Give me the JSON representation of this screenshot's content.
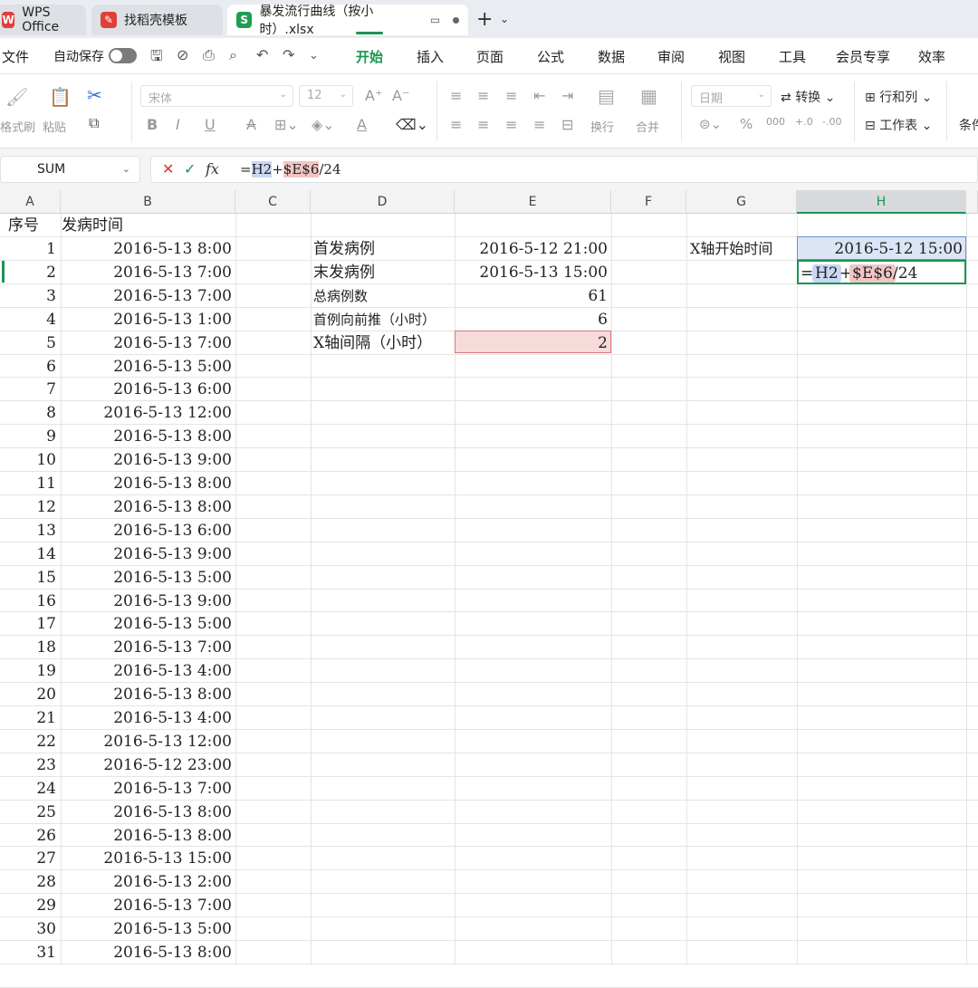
{
  "tabs": {
    "wps": "WPS Office",
    "template": "找稻壳模板",
    "file": "暴发流行曲线（按小时）.xlsx",
    "add": "+",
    "more": "⌄"
  },
  "menu": {
    "file": "文件",
    "autosave": "自动保存",
    "items": [
      "开始",
      "插入",
      "页面",
      "公式",
      "数据",
      "审阅",
      "视图",
      "工具",
      "会员专享",
      "效率"
    ],
    "active": "开始"
  },
  "ribbon": {
    "format_painter": "格式刷",
    "paste": "粘贴",
    "font_name": "宋体",
    "font_size": "12",
    "wrap": "换行",
    "merge": "合并",
    "number_format": "日期",
    "convert": "转换",
    "rows_cols": "行和列",
    "worksheet": "工作表",
    "conditional": "条件",
    "bold": "B",
    "italic": "I",
    "underline": "U",
    "strike": "A",
    "font_color": "A",
    "percent": "%",
    "thousands": "000",
    "dec_inc": "+.0",
    "dec_dec": "-.00"
  },
  "formula_bar": {
    "name_box": "SUM",
    "cancel": "✕",
    "confirm": "✓",
    "fx": "fx",
    "formula_eq": "=",
    "formula_ref1": "H2",
    "formula_plus": "+",
    "formula_ref2": "$E$6",
    "formula_tail": "/24"
  },
  "columns": [
    "A",
    "B",
    "C",
    "D",
    "E",
    "F",
    "G",
    "H"
  ],
  "selected_column": "H",
  "sheet": {
    "header_a": "序号",
    "header_b": "发病时间",
    "rows": [
      {
        "no": "1",
        "time": "2016-5-13  8:00"
      },
      {
        "no": "2",
        "time": "2016-5-13  7:00"
      },
      {
        "no": "3",
        "time": "2016-5-13  7:00"
      },
      {
        "no": "4",
        "time": "2016-5-13  1:00"
      },
      {
        "no": "5",
        "time": "2016-5-13  7:00"
      },
      {
        "no": "6",
        "time": "2016-5-13  5:00"
      },
      {
        "no": "7",
        "time": "2016-5-13  6:00"
      },
      {
        "no": "8",
        "time": "2016-5-13  12:00"
      },
      {
        "no": "9",
        "time": "2016-5-13  8:00"
      },
      {
        "no": "10",
        "time": "2016-5-13  9:00"
      },
      {
        "no": "11",
        "time": "2016-5-13  8:00"
      },
      {
        "no": "12",
        "time": "2016-5-13  8:00"
      },
      {
        "no": "13",
        "time": "2016-5-13  6:00"
      },
      {
        "no": "14",
        "time": "2016-5-13  9:00"
      },
      {
        "no": "15",
        "time": "2016-5-13  5:00"
      },
      {
        "no": "16",
        "time": "2016-5-13  9:00"
      },
      {
        "no": "17",
        "time": "2016-5-13  5:00"
      },
      {
        "no": "18",
        "time": "2016-5-13  7:00"
      },
      {
        "no": "19",
        "time": "2016-5-13  4:00"
      },
      {
        "no": "20",
        "time": "2016-5-13  8:00"
      },
      {
        "no": "21",
        "time": "2016-5-13  4:00"
      },
      {
        "no": "22",
        "time": "2016-5-13  12:00"
      },
      {
        "no": "23",
        "time": "2016-5-12  23:00"
      },
      {
        "no": "24",
        "time": "2016-5-13  7:00"
      },
      {
        "no": "25",
        "time": "2016-5-13  8:00"
      },
      {
        "no": "26",
        "time": "2016-5-13  8:00"
      },
      {
        "no": "27",
        "time": "2016-5-13  15:00"
      },
      {
        "no": "28",
        "time": "2016-5-13  2:00"
      },
      {
        "no": "29",
        "time": "2016-5-13  7:00"
      },
      {
        "no": "30",
        "time": "2016-5-13  5:00"
      },
      {
        "no": "31",
        "time": "2016-5-13  8:00"
      }
    ],
    "stats": [
      {
        "label": "首发病例",
        "value": "2016-5-12  21:00"
      },
      {
        "label": "末发病例",
        "value": "2016-5-13  15:00"
      },
      {
        "label": "总病例数",
        "value": "61"
      },
      {
        "label": "首例向前推（小时）",
        "value": "6"
      },
      {
        "label": "X轴间隔（小时）",
        "value": "2"
      }
    ],
    "g_label": "X轴开始时间",
    "h1_value": "2016-5-12  15:00"
  },
  "colors": {
    "accent": "#1a9552",
    "ref_blue": "#c9d7f2",
    "ref_red": "#f2c5c5"
  }
}
